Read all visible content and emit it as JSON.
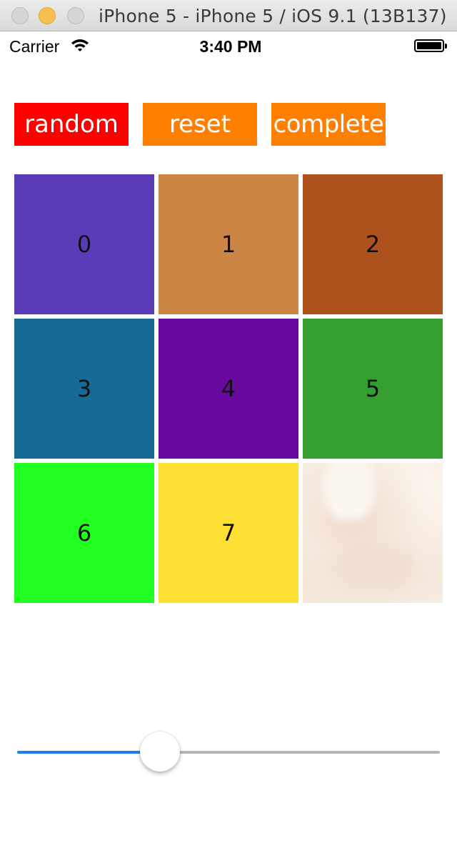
{
  "window": {
    "title": "iPhone 5 - iPhone 5 / iOS 9.1 (13B137)"
  },
  "status_bar": {
    "carrier": "Carrier",
    "wifi_icon": "wifi-icon",
    "time": "3:40 PM",
    "battery_icon": "battery-icon",
    "battery_level": 1.0
  },
  "toolbar": {
    "buttons": [
      {
        "label": "random",
        "color": "#ff0000"
      },
      {
        "label": "reset",
        "color": "#ff8000"
      },
      {
        "label": "complete",
        "color": "#ff8000"
      }
    ]
  },
  "puzzle": {
    "columns": 3,
    "rows": 3,
    "tiles": [
      {
        "label": "0",
        "color": "#5b3cb8"
      },
      {
        "label": "1",
        "color": "#cc8545"
      },
      {
        "label": "2",
        "color": "#ad521c"
      },
      {
        "label": "3",
        "color": "#156a96"
      },
      {
        "label": "4",
        "color": "#68099f"
      },
      {
        "label": "5",
        "color": "#359e30"
      },
      {
        "label": "6",
        "color": "#21ff21"
      },
      {
        "label": "7",
        "color": "#fde034"
      }
    ],
    "empty_slot": 8
  },
  "slider": {
    "value": 0.32,
    "min_track_color": "#1a7ef5",
    "max_track_color": "#b6b6b6"
  }
}
